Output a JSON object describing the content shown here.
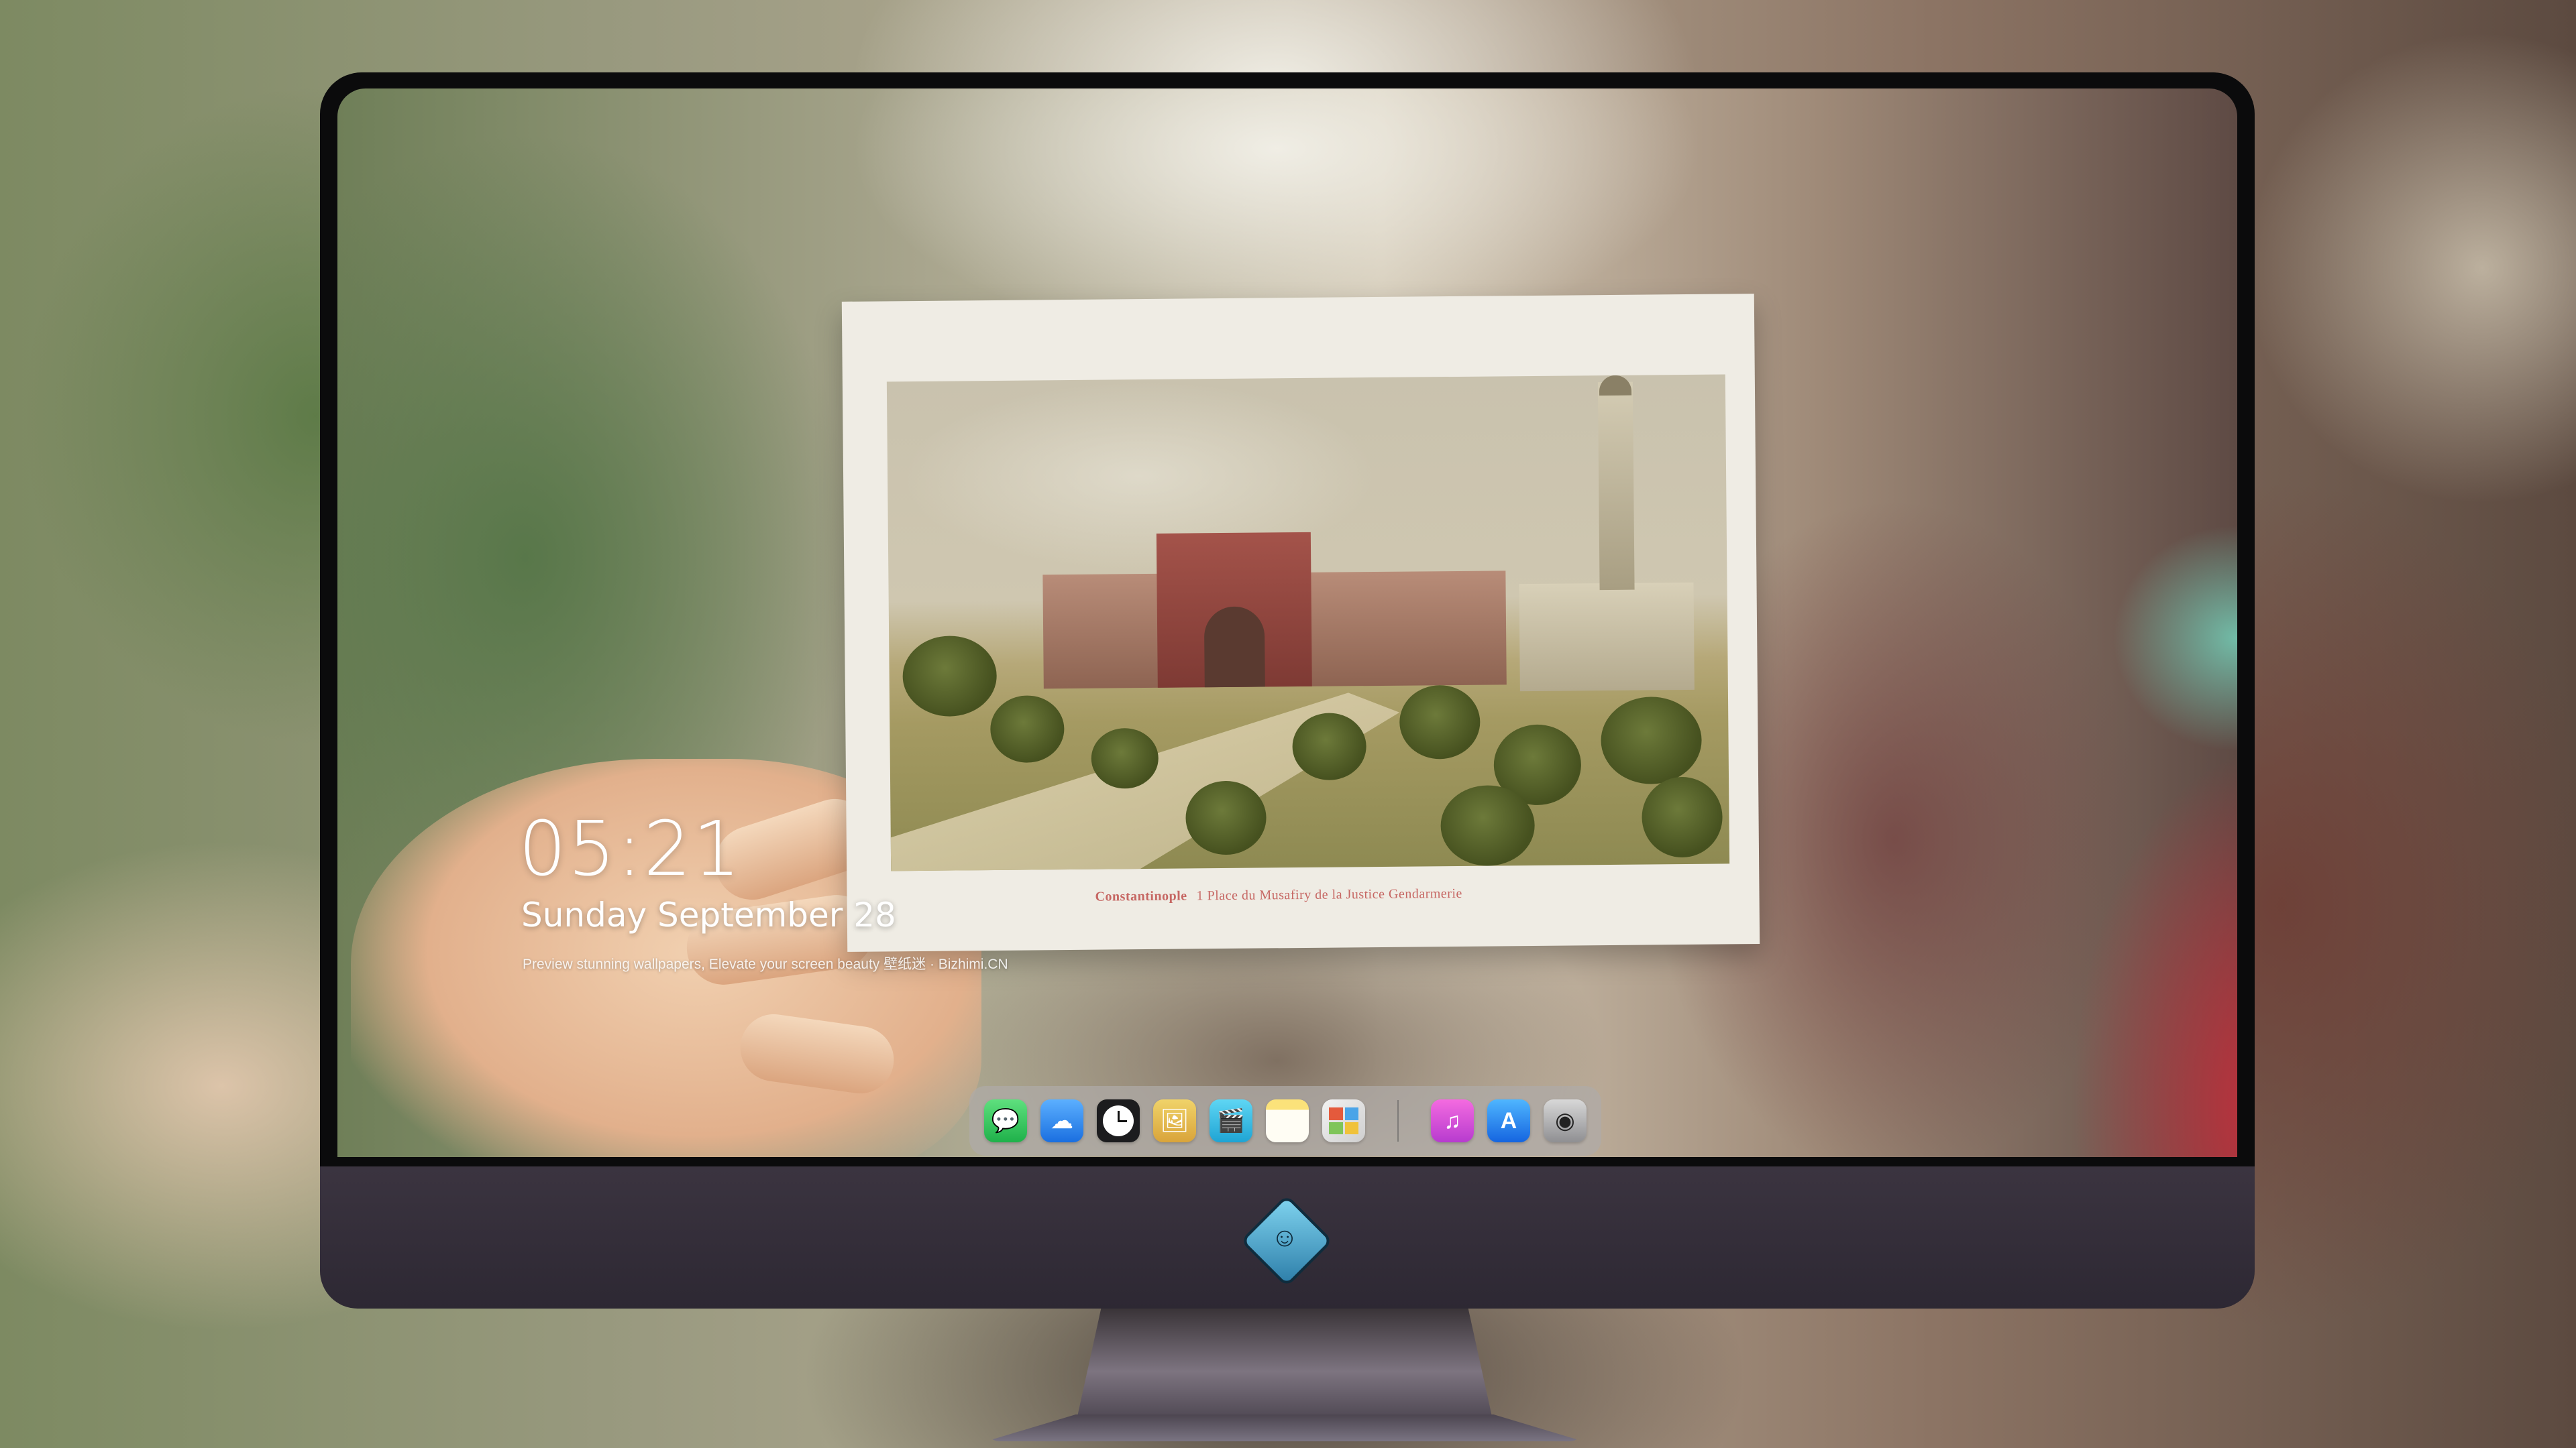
{
  "lock_screen": {
    "time": "05:21",
    "date": "Sunday September  28",
    "tagline": "Preview stunning wallpapers, Elevate your screen beauty  壁纸迷 · Bizhimi.CN"
  },
  "postcard": {
    "caption_title": "Constantinople",
    "caption_text": "1  Place du Musafiry de la Justice Gendarmerie"
  },
  "dock": {
    "apps": [
      {
        "name": "Messages",
        "icon": "messages-icon",
        "color": "#31c75a",
        "glyph": "💬"
      },
      {
        "name": "Weather",
        "icon": "weather-icon",
        "color": "#2f8af0",
        "glyph": "☁"
      },
      {
        "name": "Clock",
        "icon": "clock-icon",
        "color": "#1c1c1e",
        "glyph": "🕘"
      },
      {
        "name": "Preview",
        "icon": "preview-icon",
        "color": "#e8c24a",
        "glyph": "🖼"
      },
      {
        "name": "Final Cut",
        "icon": "clapperboard-icon",
        "color": "#2bc1e6",
        "glyph": "🎬"
      },
      {
        "name": "Notes",
        "icon": "notes-icon",
        "color": "#f7d44c",
        "glyph": "☰"
      },
      {
        "name": "Photo Booth",
        "icon": "photo-booth-icon",
        "color": "#d9453d",
        "glyph": "▦"
      }
    ],
    "apps_right": [
      {
        "name": "iTunes",
        "icon": "music-icon",
        "color": "#d54bd0",
        "glyph": "♫"
      },
      {
        "name": "App Store",
        "icon": "app-store-icon",
        "color": "#2f8af0",
        "glyph": "A"
      },
      {
        "name": "Camera",
        "icon": "camera-icon",
        "color": "#4a4a4c",
        "glyph": "◉"
      }
    ]
  },
  "monitor": {
    "logo": "bizhimi-logo-icon"
  }
}
